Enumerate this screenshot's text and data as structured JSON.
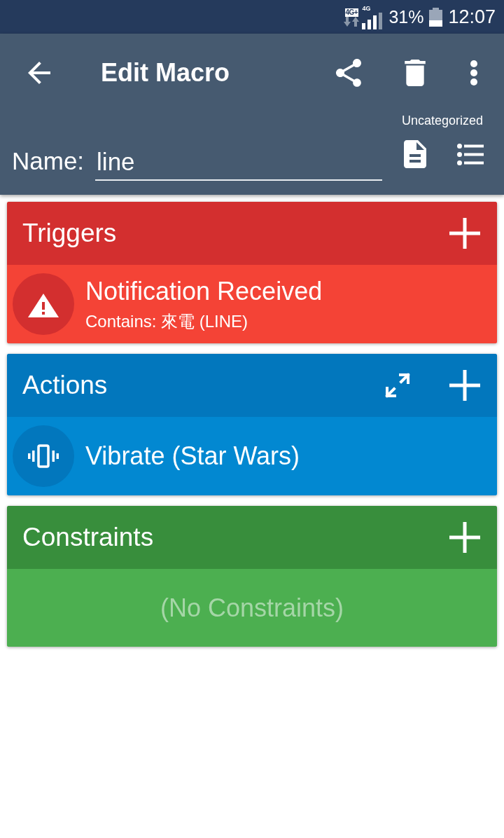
{
  "status_bar": {
    "network_badge": "4G+",
    "signal_label": "4G",
    "battery": "31%",
    "time": "12:07"
  },
  "toolbar": {
    "title": "Edit Macro"
  },
  "macro": {
    "category": "Uncategorized",
    "name_label": "Name:",
    "name_value": "line"
  },
  "sections": [
    {
      "kind": "triggers",
      "title": "Triggers",
      "expandable": false,
      "items": [
        {
          "title": "Notification Received",
          "detail": "Contains: 來電 (LINE)"
        }
      ]
    },
    {
      "kind": "actions",
      "title": "Actions",
      "expandable": true,
      "items": [
        {
          "title": "Vibrate (Star Wars)"
        }
      ]
    },
    {
      "kind": "constraints",
      "title": "Constraints",
      "expandable": false,
      "empty_text": "(No Constraints)"
    }
  ]
}
